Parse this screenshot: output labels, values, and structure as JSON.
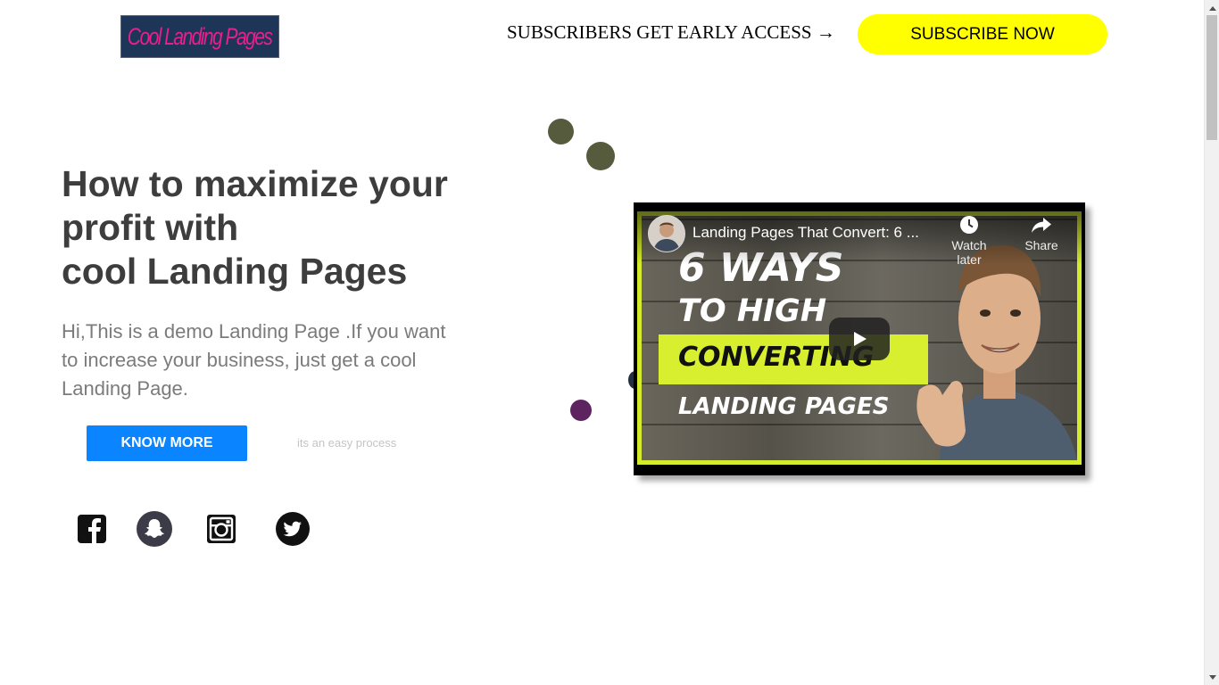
{
  "header": {
    "logo_text": "Cool Landing Pages",
    "tagline": "SUBSCRIBERS GET EARLY ACCESS →",
    "subscribe_label": "SUBSCRIBE NOW"
  },
  "hero": {
    "headline_lines": [
      "How to maximize your",
      "profit with",
      "cool Landing Pages"
    ],
    "intro": "Hi,This is a demo Landing Page .If you want to increase your business, just get a cool Landing Page.",
    "cta_label": "KNOW MORE",
    "cta_note": "its an easy process"
  },
  "social": {
    "icons": [
      "facebook-icon",
      "snapchat-icon",
      "instagram-icon",
      "twitter-icon"
    ]
  },
  "video": {
    "title": "Landing Pages That Convert: 6 ...",
    "watch_later_label": "Watch later",
    "share_label": "Share",
    "thumbnail_text": {
      "line1": "6 WAYS",
      "line2": "TO HIGH",
      "line3": "CONVERTING",
      "line4": "LANDING PAGES"
    }
  },
  "colors": {
    "subscribe_bg": "#ffff00",
    "cta_bg": "#0a84ff",
    "headline": "#3d3d3d",
    "intro": "#7b7b7b",
    "dot_olive": "#565b3e",
    "dot_purple": "#5e2460",
    "thumb_accent": "#d4ec2c"
  }
}
